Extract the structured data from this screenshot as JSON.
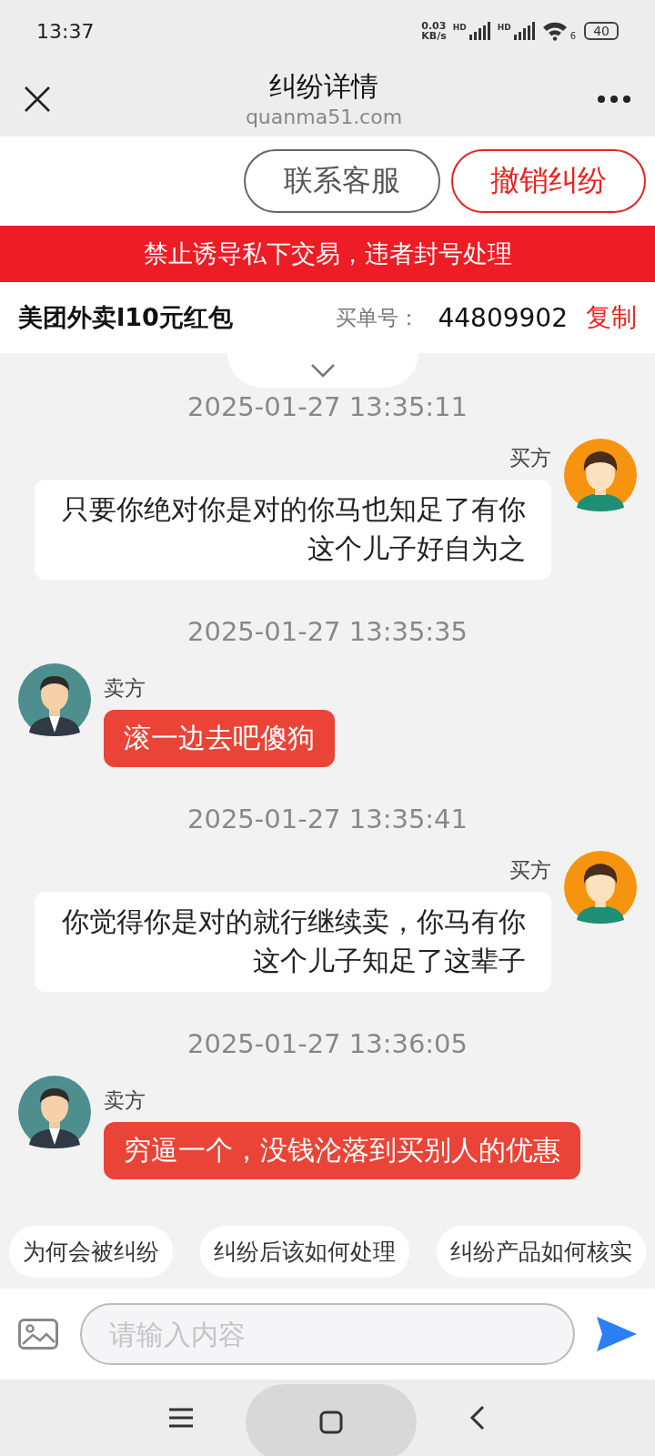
{
  "status_bar": {
    "time": "13:37",
    "speed": "0.03",
    "speed_unit": "KB/s",
    "sim_labels": [
      "HD",
      "HD"
    ],
    "wifi_label": "6",
    "battery": "40"
  },
  "header": {
    "title": "纠纷详情",
    "subtitle": "quanma51.com"
  },
  "actions": [
    {
      "label": "联系客服",
      "kind": "outline"
    },
    {
      "label": "撤销纠纷",
      "kind": "danger"
    }
  ],
  "notice": "禁止诱导私下交易，违者封号处理",
  "order": {
    "product": "美团外卖l10元红包",
    "number_label": "买单号：",
    "number": "44809902",
    "copy": "复制"
  },
  "messages": [
    {
      "kind": "time",
      "text": "2025-01-27 13:35:11"
    },
    {
      "kind": "buyer",
      "name": "买方",
      "text": "只要你绝对你是对的你马也知足了有你这个儿子好自为之"
    },
    {
      "kind": "time",
      "text": "2025-01-27 13:35:35"
    },
    {
      "kind": "seller",
      "name": "卖方",
      "text": "滚一边去吧傻狗"
    },
    {
      "kind": "time",
      "text": "2025-01-27 13:35:41"
    },
    {
      "kind": "buyer",
      "name": "买方",
      "text": "你觉得你是对的就行继续卖，你马有你这个儿子知足了这辈子"
    },
    {
      "kind": "time",
      "text": "2025-01-27 13:36:05"
    },
    {
      "kind": "seller",
      "name": "卖方",
      "text": "穷逼一个，没钱沦落到买别人的优惠"
    }
  ],
  "chips": [
    "为何会被纠纷",
    "纠纷后该如何处理",
    "纠纷产品如何核实"
  ],
  "input": {
    "placeholder": "请输入内容"
  }
}
